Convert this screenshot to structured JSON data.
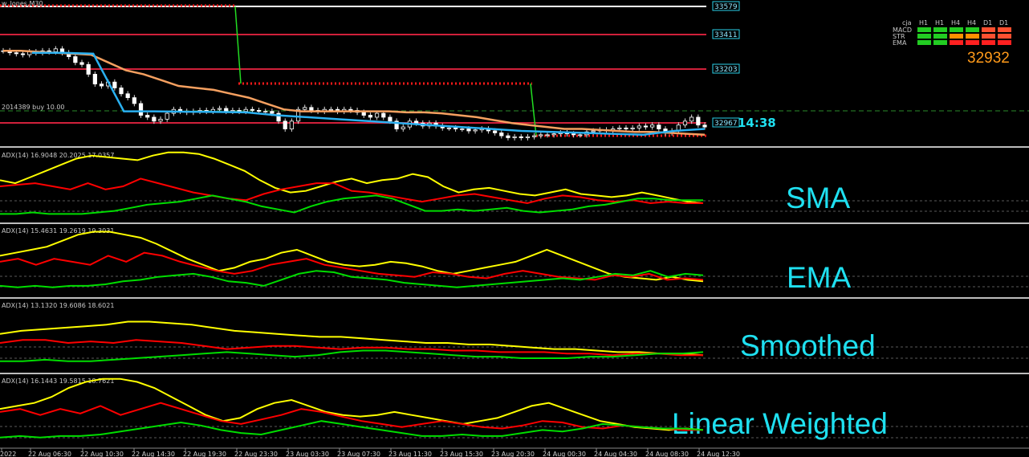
{
  "chart_data": [
    {
      "type": "candlestick",
      "title": "w_Jones,M30",
      "trade_label": "2014389 buy 10.00",
      "countdown": "14:38",
      "price_labels": [
        "33579",
        "33411",
        "33203",
        "32967"
      ],
      "closes": [
        33360,
        33350,
        33345,
        33340,
        33355,
        33350,
        33360,
        33355,
        33370,
        33350,
        33330,
        33300,
        33290,
        33240,
        33190,
        33180,
        33200,
        33170,
        33140,
        33120,
        33090,
        33030,
        33020,
        33000,
        33010,
        33040,
        33060,
        33050,
        33045,
        33050,
        33055,
        33050,
        33060,
        33065,
        33050,
        33055,
        33050,
        33060,
        33055,
        33050,
        33050,
        33040,
        33000,
        32960,
        33000,
        33060,
        33070,
        33055,
        33050,
        33060,
        33060,
        33050,
        33060,
        33055,
        33045,
        33030,
        33020,
        33040,
        33020,
        33000,
        32960,
        32970,
        33000,
        32990,
        32975,
        32990,
        32975,
        32965,
        32965,
        32960,
        32960,
        32950,
        32955,
        32960,
        32950,
        32940,
        32925,
        32915,
        32920,
        32915,
        32920,
        32925,
        32930,
        32930,
        32935,
        32940,
        32935,
        32930,
        32930,
        32945,
        32950,
        32955,
        32950,
        32960,
        32965,
        32960,
        32965,
        32975,
        32970,
        32980,
        32960,
        32940,
        32950,
        32980,
        33000,
        33020,
        32980,
        32970
      ],
      "series": [
        {
          "name": "",
          "color": "#f5a060",
          "values": [
            33360,
            33360,
            33355,
            33350,
            33345,
            33340,
            33300,
            33260,
            33240,
            33210,
            33180,
            33170,
            33160,
            33140,
            33120,
            33090,
            33060,
            33050,
            33050,
            33050,
            33050,
            33050,
            33050,
            33045,
            33045,
            33040,
            33030,
            33020,
            33005,
            32990,
            32980,
            32970,
            32960,
            32960,
            32955,
            32950,
            32945,
            32945,
            32940,
            32935,
            32930
          ]
        },
        {
          "name": "",
          "color": "#2ab0f0",
          "values": [
            33350,
            33350,
            33345,
            33050,
            33050,
            33048,
            33047,
            33045,
            33030,
            33020,
            33010,
            33000,
            32990,
            32980,
            32970,
            32960,
            32950,
            32945,
            32940,
            32935,
            32930,
            32950,
            32960
          ]
        }
      ]
    },
    {
      "type": "line",
      "title": "SMA",
      "header": "ADX(14) 16.9048 20.2025 17.0357",
      "series": [
        {
          "name": "",
          "color": "#ffff00",
          "values": [
            32,
            30,
            34,
            38,
            42,
            46,
            48,
            47,
            46,
            45,
            48,
            50,
            50,
            49,
            46,
            42,
            38,
            32,
            27,
            24,
            25,
            28,
            31,
            33,
            30,
            32,
            33,
            36,
            34,
            28,
            24,
            26,
            27,
            25,
            23,
            22,
            24,
            26,
            23,
            22,
            21,
            22,
            24,
            22,
            20,
            18,
            17
          ]
        },
        {
          "name": "",
          "color": "#ff0000",
          "values": [
            28,
            29,
            30,
            28,
            26,
            30,
            26,
            28,
            33,
            30,
            27,
            24,
            22,
            20,
            19,
            23,
            26,
            28,
            30,
            30,
            25,
            24,
            22,
            20,
            18,
            20,
            22,
            23,
            21,
            19,
            17,
            20,
            22,
            21,
            19,
            18,
            19,
            17,
            18,
            17,
            17
          ]
        },
        {
          "name": "",
          "color": "#00dd00",
          "values": [
            10,
            10,
            11,
            10,
            10,
            10,
            11,
            12,
            14,
            16,
            17,
            18,
            20,
            22,
            20,
            18,
            15,
            13,
            11,
            15,
            18,
            20,
            21,
            22,
            20,
            16,
            12,
            12,
            13,
            12,
            13,
            14,
            12,
            11,
            12,
            13,
            15,
            16,
            18,
            20,
            20,
            19,
            19,
            19
          ]
        }
      ]
    },
    {
      "type": "line",
      "title": "EMA",
      "header": "ADX(14) 15.4631 19.2619 19.3031",
      "series": [
        {
          "name": "",
          "color": "#ffff00",
          "values": [
            32,
            34,
            36,
            38,
            42,
            46,
            48,
            48,
            46,
            44,
            40,
            35,
            30,
            26,
            22,
            24,
            28,
            30,
            34,
            36,
            32,
            28,
            26,
            25,
            26,
            28,
            27,
            25,
            22,
            20,
            22,
            24,
            26,
            28,
            32,
            36,
            32,
            28,
            24,
            20,
            18,
            17,
            16,
            18,
            16,
            15
          ]
        },
        {
          "name": "",
          "color": "#ff0000",
          "values": [
            28,
            30,
            26,
            30,
            28,
            26,
            32,
            28,
            34,
            32,
            28,
            25,
            22,
            20,
            22,
            26,
            28,
            30,
            26,
            24,
            22,
            20,
            19,
            18,
            21,
            20,
            18,
            17,
            20,
            22,
            20,
            18,
            17,
            16,
            19,
            18,
            20,
            16,
            17,
            16
          ]
        },
        {
          "name": "",
          "color": "#00dd00",
          "values": [
            12,
            11,
            12,
            11,
            12,
            12,
            13,
            15,
            16,
            18,
            19,
            20,
            18,
            15,
            14,
            12,
            16,
            20,
            22,
            21,
            18,
            17,
            16,
            14,
            13,
            12,
            11,
            12,
            13,
            14,
            15,
            16,
            17,
            16,
            18,
            20,
            19,
            22,
            18,
            20,
            19
          ]
        }
      ]
    },
    {
      "type": "line",
      "title": "Smoothed",
      "header": "ADX(14) 13.1320 19.6086 18.6021",
      "series": [
        {
          "name": "",
          "color": "#ffff00",
          "values": [
            30,
            32,
            33,
            34,
            35,
            36,
            38,
            38,
            37,
            36,
            34,
            32,
            31,
            30,
            29,
            28,
            28,
            27,
            26,
            25,
            24,
            24,
            23,
            23,
            22,
            21,
            20,
            20,
            19,
            18,
            18,
            17,
            17,
            16
          ]
        },
        {
          "name": "",
          "color": "#ff0000",
          "values": [
            24,
            26,
            26,
            24,
            25,
            24,
            26,
            25,
            24,
            22,
            20,
            21,
            22,
            22,
            21,
            20,
            21,
            21,
            20,
            20,
            19,
            19,
            18,
            18,
            18,
            17,
            17,
            16,
            17,
            17,
            16,
            16
          ]
        },
        {
          "name": "",
          "color": "#00dd00",
          "values": [
            12,
            12,
            13,
            12,
            12,
            13,
            14,
            15,
            16,
            17,
            18,
            17,
            16,
            15,
            16,
            18,
            19,
            19,
            18,
            17,
            16,
            15,
            15,
            14,
            14,
            14,
            15,
            15,
            16,
            17,
            17,
            18
          ]
        }
      ]
    },
    {
      "type": "line",
      "title": "Linear Weighted",
      "header": "ADX(14) 16.1443 19.5815 18.7621",
      "series": [
        {
          "name": "",
          "color": "#ffff00",
          "values": [
            30,
            32,
            34,
            38,
            44,
            48,
            50,
            50,
            48,
            44,
            38,
            32,
            26,
            22,
            24,
            30,
            34,
            36,
            32,
            28,
            26,
            25,
            26,
            28,
            26,
            24,
            22,
            20,
            22,
            24,
            28,
            32,
            34,
            30,
            26,
            22,
            20,
            18,
            17,
            16,
            17,
            16
          ]
        },
        {
          "name": "",
          "color": "#ff0000",
          "values": [
            28,
            30,
            26,
            30,
            27,
            32,
            26,
            30,
            34,
            30,
            26,
            22,
            20,
            23,
            26,
            30,
            28,
            25,
            22,
            20,
            18,
            20,
            22,
            20,
            18,
            17,
            19,
            22,
            21,
            18,
            17,
            19,
            18,
            17,
            16,
            16
          ]
        },
        {
          "name": "",
          "color": "#00dd00",
          "values": [
            11,
            12,
            11,
            12,
            12,
            13,
            15,
            17,
            19,
            21,
            19,
            16,
            14,
            13,
            16,
            19,
            22,
            20,
            18,
            16,
            14,
            12,
            12,
            13,
            12,
            12,
            14,
            16,
            15,
            17,
            20,
            19,
            18,
            17,
            17,
            16
          ]
        }
      ]
    }
  ],
  "time_axis": [
    "2022",
    "22 Aug 06:30",
    "22 Aug 10:30",
    "22 Aug 14:30",
    "22 Aug 19:30",
    "22 Aug 23:30",
    "23 Aug 03:30",
    "23 Aug 07:30",
    "23 Aug 11:30",
    "23 Aug 15:30",
    "23 Aug 20:30",
    "24 Aug 00:30",
    "24 Aug 04:30",
    "24 Aug 08:30",
    "24 Aug 12:30"
  ],
  "dashboard": {
    "top_label": "cja",
    "timeframes": [
      "H1",
      "H1",
      "H4",
      "H4",
      "D1",
      "D1"
    ],
    "row_labels": [
      "MACD",
      "STR",
      "EMA"
    ],
    "price": "32932",
    "colors": [
      [
        "#22cc22",
        "#22cc22",
        "#22cc22",
        "#22cc22",
        "#ff5030",
        "#ff5030"
      ],
      [
        "#22cc22",
        "#22cc22",
        "#ff9000",
        "#ff9000",
        "#ff5030",
        "#ff5030"
      ],
      [
        "#22cc22",
        "#22cc22",
        "#ff2020",
        "#ff2020",
        "#ff2020",
        "#ff2020"
      ]
    ]
  }
}
